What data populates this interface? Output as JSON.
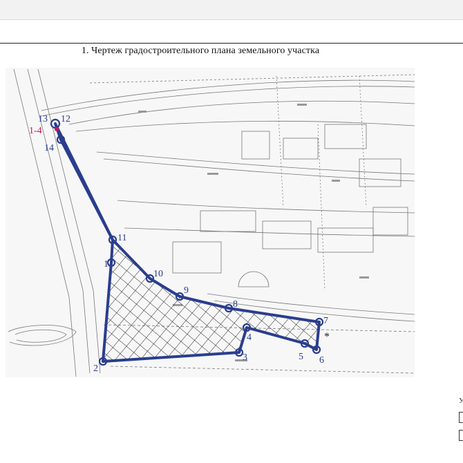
{
  "document": {
    "title": "1. Чертеж градостроительного плана земельного участка"
  },
  "plot": {
    "boundary_color": "#2a3d8f",
    "point_marker_color": "#2a3d8f",
    "highlight_color": "#c2185b",
    "points": [
      {
        "id": "1",
        "label": "1"
      },
      {
        "id": "2",
        "label": "2"
      },
      {
        "id": "3",
        "label": "3"
      },
      {
        "id": "4",
        "label": "4"
      },
      {
        "id": "5",
        "label": "5"
      },
      {
        "id": "6",
        "label": "6"
      },
      {
        "id": "7",
        "label": "7"
      },
      {
        "id": "8",
        "label": "8"
      },
      {
        "id": "9",
        "label": "9"
      },
      {
        "id": "10",
        "label": "10"
      },
      {
        "id": "11",
        "label": "11"
      },
      {
        "id": "12",
        "label": "12"
      },
      {
        "id": "13",
        "label": "13"
      },
      {
        "id": "14",
        "label": "14"
      }
    ],
    "highlight_label": "1-4",
    "star_mark": "*"
  },
  "legend": {
    "label": "У"
  }
}
